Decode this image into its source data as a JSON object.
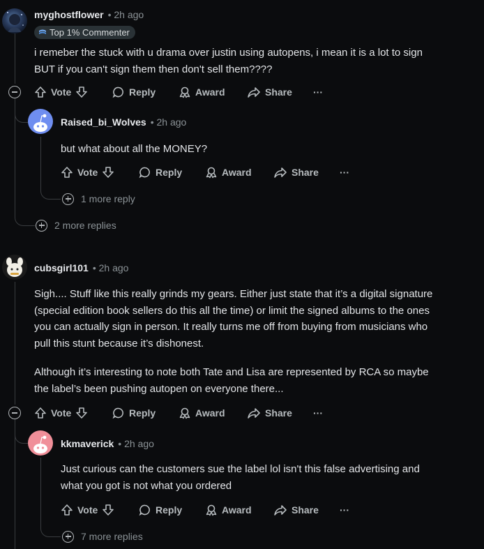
{
  "comments": [
    {
      "username": "myghostflower",
      "time": "• 2h ago",
      "flair": "Top 1% Commenter",
      "text": [
        "i remeber the stuck with u drama over justin using autopens, i mean it is a lot to sign",
        "BUT if you can't sign them then don't sell them????"
      ],
      "actions": {
        "vote": "Vote",
        "reply": "Reply",
        "award": "Award",
        "share": "Share",
        "more": "···"
      },
      "more_replies": "2 more replies"
    },
    {
      "username": "Raised_bi_Wolves",
      "time": "• 2h ago",
      "text": [
        "but what about all the MONEY?"
      ],
      "actions": {
        "vote": "Vote",
        "reply": "Reply",
        "award": "Award",
        "share": "Share",
        "more": "···"
      },
      "more_replies": "1 more reply"
    },
    {
      "username": "cubsgirl101",
      "time": "• 2h ago",
      "text": [
        "Sigh.... Stuff like this really grinds my gears. Either just state that it’s a digital signature",
        "(special edition book sellers do this all the time) or limit the signed albums to the ones",
        "you can actually sign in person. It really turns me off from buying from musicians who",
        "pull this stunt because it’s dishonest.",
        "Although it’s interesting to note both Tate and Lisa are represented by RCA so maybe",
        "the label’s been pushing autopen on everyone there..."
      ],
      "actions": {
        "vote": "Vote",
        "reply": "Reply",
        "award": "Award",
        "share": "Share",
        "more": "···"
      }
    },
    {
      "username": "kkmaverick",
      "time": "• 2h ago",
      "text": [
        "Just curious can the customers sue the label lol isn't this false advertising and",
        "what you got is not what you ordered"
      ],
      "actions": {
        "vote": "Vote",
        "reply": "Reply",
        "award": "Award",
        "share": "Share",
        "more": "···"
      },
      "more_replies": "7 more replies"
    }
  ],
  "colors": {
    "background": "#0b0c0e",
    "text": "#d7dadc",
    "muted": "#8b9296",
    "thread_line": "#3a3d40",
    "avatar_blue": "#6f8ef0",
    "avatar_pink": "#f08f99"
  },
  "icons": [
    "upvote-icon",
    "downvote-icon",
    "reply-bubble-icon",
    "award-icon",
    "share-icon",
    "more-options-icon",
    "collapse-icon",
    "expand-plus-icon"
  ]
}
